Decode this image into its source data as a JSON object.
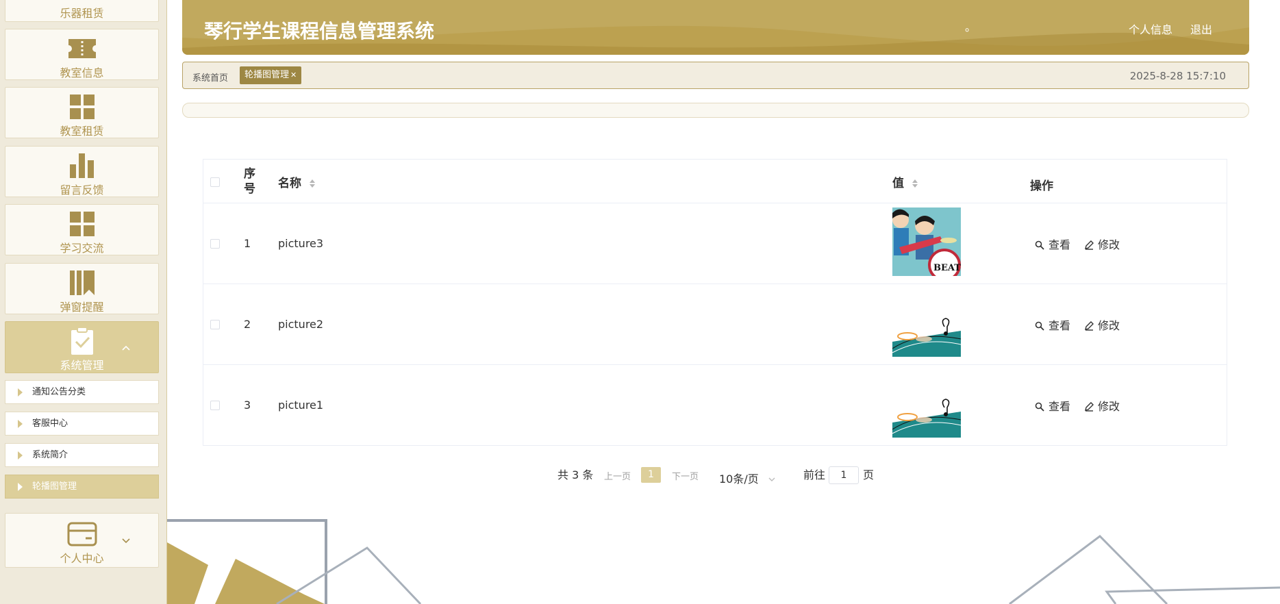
{
  "app": {
    "title": "琴行学生课程信息管理系统",
    "header_links": [
      "个人信息",
      "退出"
    ],
    "header_dot": "。"
  },
  "sidebar": {
    "cards": [
      {
        "label": "乐器租赁",
        "icon": "card-icon"
      },
      {
        "label": "教室信息",
        "icon": "ticket-icon"
      },
      {
        "label": "教室租赁",
        "icon": "grid-icon"
      },
      {
        "label": "留言反馈",
        "icon": "bar-chart-icon"
      },
      {
        "label": "学习交流",
        "icon": "grid-icon"
      },
      {
        "label": "弹窗提醒",
        "icon": "books-icon"
      },
      {
        "label": "系统管理",
        "icon": "clipboard-check-icon"
      },
      {
        "label": "个人中心",
        "icon": "wallet-icon"
      }
    ],
    "sub_items": [
      "通知公告分类",
      "客服中心",
      "系统简介",
      "轮播图管理"
    ]
  },
  "breadcrumb": {
    "home": "系统首页",
    "active_tab": "轮播图管理",
    "close_glyph": "✕",
    "datetime": "2025-8-28 15:7:10"
  },
  "table": {
    "columns": [
      "序号",
      "名称",
      "值",
      "操作"
    ],
    "index_header_lines": [
      "序",
      "号"
    ],
    "rows": [
      {
        "index": "1",
        "name": "picture3",
        "image": "beatles-cartoon"
      },
      {
        "index": "2",
        "name": "picture2",
        "image": "music-teal"
      },
      {
        "index": "3",
        "name": "picture1",
        "image": "music-teal"
      }
    ],
    "actions": {
      "view": "查看",
      "edit": "修改"
    }
  },
  "pagination": {
    "total": "共 3 条",
    "prev": "上一页",
    "current": "1",
    "next": "下一页",
    "page_size": "10条/页",
    "goto_prefix": "前往",
    "goto_value": "1",
    "goto_suffix": "页"
  },
  "colors": {
    "accent": "#c1a95e",
    "accent_dark": "#9d8743",
    "accent_light": "#ddcf9a",
    "sidebar_bg": "#efeadb"
  }
}
